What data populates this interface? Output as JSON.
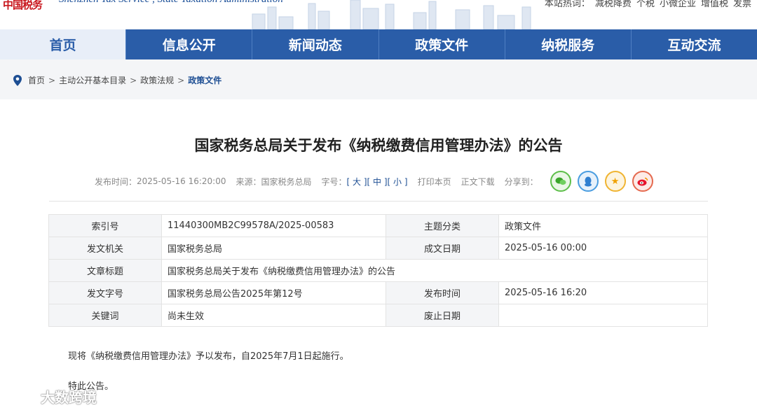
{
  "header": {
    "logo_text": "中国税务",
    "subtitle": "Shenzhen Tax Service , State Taxation Administration",
    "quick_links": [
      "本站热词：",
      "减税降费",
      "个税",
      "小微企业",
      "增值税",
      "发票"
    ]
  },
  "nav": [
    "首页",
    "信息公开",
    "新闻动态",
    "政策文件",
    "纳税服务",
    "互动交流"
  ],
  "breadcrumb": [
    "首页",
    "主动公开基本目录",
    "政策法规",
    "政策文件"
  ],
  "article": {
    "title": "国家税务总局关于发布《纳税缴费信用管理办法》的公告",
    "publish_label": "发布时间：",
    "publish_time": "2025-05-16 16:20:00",
    "source_label": "来源：",
    "source": "国家税务总局",
    "font_label": "字号：",
    "font_large": "大",
    "font_medium": "中",
    "font_small": "小",
    "print": "打印本页",
    "download": "正文下载",
    "share_label": "分享到："
  },
  "info": {
    "index_label": "索引号",
    "index": "11440300MB2C99578A/2025-00583",
    "topic_label": "主题分类",
    "topic": "政策文件",
    "issuer_label": "发文机关",
    "issuer": "国家税务总局",
    "date_label": "成文日期",
    "date": "2025-05-16 00:00",
    "doc_title_label": "文章标题",
    "doc_title": "国家税务总局关于发布《纳税缴费信用管理办法》的公告",
    "docno_label": "发文字号",
    "docno": "国家税务总局公告2025年第12号",
    "pubtime_label": "发布时间",
    "pubtime": "2025-05-16 16:20",
    "keyword_label": "关键词",
    "keyword": "尚未生效",
    "abolish_label": "废止日期",
    "abolish": ""
  },
  "body": {
    "p1": "现将《纳税缴费信用管理办法》予以发布，自2025年7月1日起施行。",
    "p2": "特此公告。"
  },
  "watermark": "大数跨境",
  "colors": {
    "nav_bg": "#2a5da8",
    "accent": "#1d4e93",
    "logo_red": "#c8161d"
  }
}
